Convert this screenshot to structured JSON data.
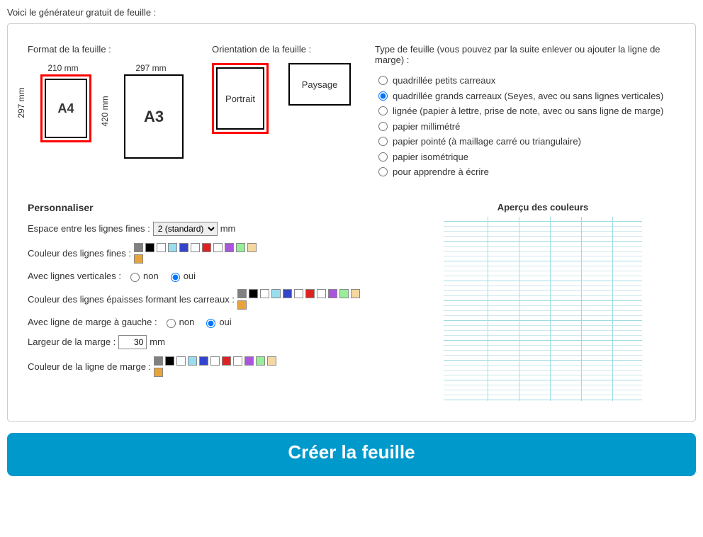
{
  "intro": "Voici le générateur gratuit de feuille :",
  "format": {
    "title": "Format de la feuille :",
    "a4": {
      "label": "A4",
      "width": "210 mm",
      "height": "297 mm",
      "selected": true
    },
    "a3": {
      "label": "A3",
      "width": "297 mm",
      "height": "420 mm",
      "selected": false
    }
  },
  "orientation": {
    "title": "Orientation de la feuille :",
    "portrait": {
      "label": "Portrait",
      "selected": true
    },
    "paysage": {
      "label": "Paysage",
      "selected": false
    }
  },
  "sheetType": {
    "title": "Type de feuille (vous pouvez par la suite enlever ou ajouter la ligne de marge) :",
    "options": [
      {
        "label": "quadrillée petits carreaux",
        "checked": false
      },
      {
        "label": "quadrillée grands carreaux (Seyes, avec ou sans lignes verticales)",
        "checked": true
      },
      {
        "label": "lignée (papier à lettre, prise de note, avec ou sans ligne de marge)",
        "checked": false
      },
      {
        "label": "papier millimétré",
        "checked": false
      },
      {
        "label": "papier pointé (à maillage carré ou triangulaire)",
        "checked": false
      },
      {
        "label": "papier isométrique",
        "checked": false
      },
      {
        "label": "pour apprendre à écrire",
        "checked": false
      }
    ]
  },
  "customize": {
    "title": "Personnaliser",
    "fineSpacing": {
      "label": "Espace entre les lignes fines :",
      "value": "2 (standard)",
      "unit": "mm"
    },
    "fineColor": {
      "label": "Couleur des lignes fines :"
    },
    "verticalLines": {
      "label": "Avec lignes verticales :",
      "non": "non",
      "oui": "oui",
      "value": "oui"
    },
    "thickColor": {
      "label": "Couleur des lignes épaisses formant les carreaux :"
    },
    "leftMargin": {
      "label": "Avec ligne de marge à gauche :",
      "non": "non",
      "oui": "oui",
      "value": "oui"
    },
    "marginWidth": {
      "label": "Largeur de la marge :",
      "value": "30",
      "unit": "mm"
    },
    "marginColor": {
      "label": "Couleur de la ligne de marge :"
    }
  },
  "colorPalette": [
    "#808080",
    "#000000",
    "#ffffff",
    "#99ddee",
    "#3344cc",
    "#ffffff",
    "#dd2222",
    "#ffffff",
    "#aa55dd",
    "#99ee99",
    "#f5d7a0",
    "#e8a33c"
  ],
  "preview": {
    "title": "Aperçu des couleurs"
  },
  "createButton": "Créer la feuille"
}
